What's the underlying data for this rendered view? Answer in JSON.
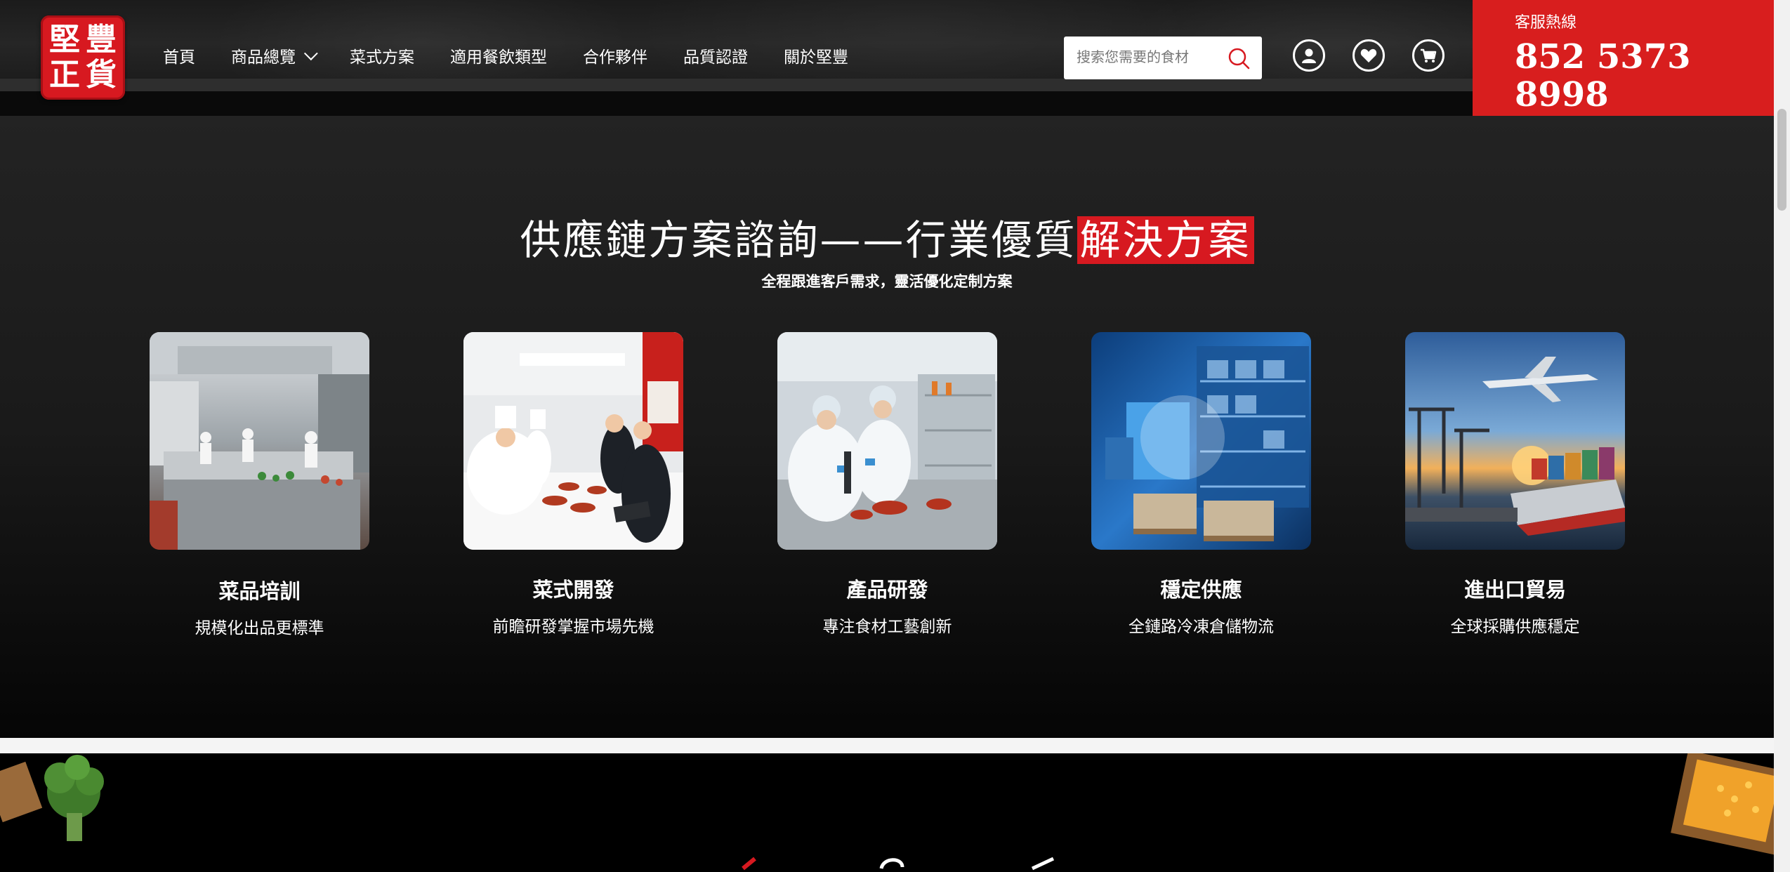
{
  "logo": {
    "chars": [
      "豐",
      "堅",
      "正",
      "貨"
    ]
  },
  "nav": {
    "items": [
      {
        "label": "首頁"
      },
      {
        "label": "商品總覽"
      },
      {
        "label": "菜式方案"
      },
      {
        "label": "適用餐飲類型"
      },
      {
        "label": "合作夥伴"
      },
      {
        "label": "品質認證"
      },
      {
        "label": "關於堅豐"
      }
    ]
  },
  "search": {
    "placeholder": "搜索您需要的食材",
    "value": ""
  },
  "header_icons": [
    "user-icon",
    "heart-icon",
    "cart-icon",
    "search-icon",
    "chevron-down-icon"
  ],
  "hotline": {
    "label": "客服熱線",
    "number": "852 5373 8998"
  },
  "section": {
    "title_main": "供應鏈方案諮詢——行業優質",
    "title_highlight": "解決方案",
    "subtitle": "全程跟進客戶需求，靈活優化定制方案",
    "cards": [
      {
        "title": "菜品培訓",
        "subtitle": "規模化出品更標準"
      },
      {
        "title": "菜式開發",
        "subtitle": "前瞻研發掌握市場先機"
      },
      {
        "title": "產品研發",
        "subtitle": "專注食材工藝創新"
      },
      {
        "title": "穩定供應",
        "subtitle": "全鏈路冷凍倉儲物流"
      },
      {
        "title": "進出口貿易",
        "subtitle": "全球採購供應穩定"
      }
    ]
  },
  "colors": {
    "brand_red": "#d71920",
    "hotline_red": "#d81e1e",
    "dark_bg": "#1a1a1a"
  }
}
